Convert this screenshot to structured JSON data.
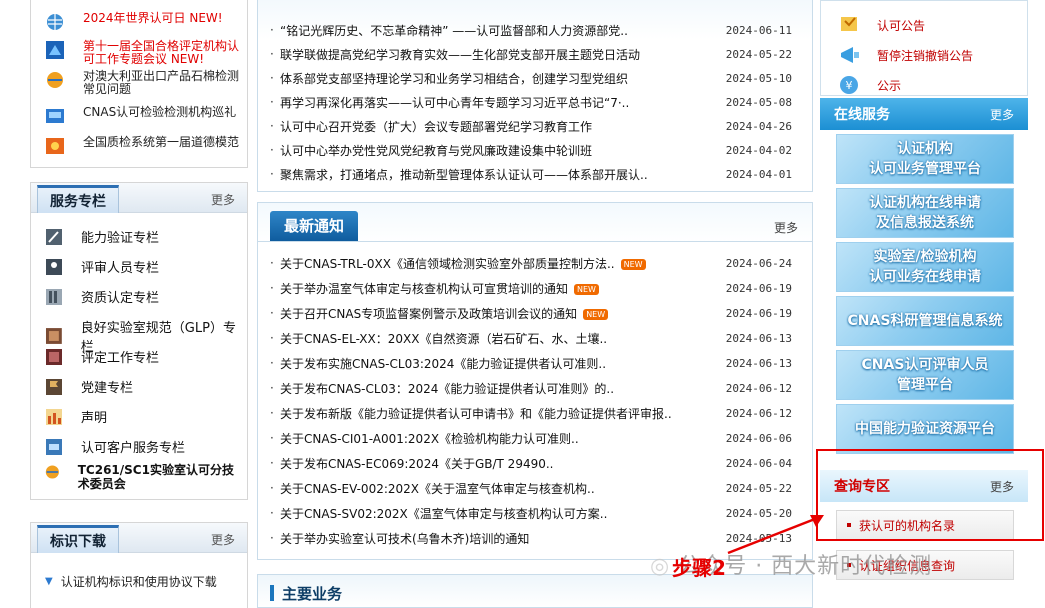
{
  "left": {
    "top_items": [
      {
        "icon": "globe-icon",
        "text": "2024年世界认可日 NEW!",
        "red": true
      },
      {
        "icon": "flag-icon",
        "text": "第十一届全国合格评定机构认可工作专题会议 NEW!",
        "red": true
      },
      {
        "icon": "globe-icon",
        "text": "对澳大利亚出口产品石棉检测常见问题",
        "red": false
      },
      {
        "icon": "building-icon",
        "text": "CNAS认可检验检测机构巡礼",
        "red": false
      },
      {
        "icon": "award-icon",
        "text": "全国质检系统第一届道德模范",
        "red": false
      }
    ],
    "service_panel": {
      "title": "服务专栏",
      "more": "更多",
      "items": [
        {
          "icon": "pen-icon",
          "label": "能力验证专栏"
        },
        {
          "icon": "people-icon",
          "label": "评审人员专栏"
        },
        {
          "icon": "book-icon",
          "label": "资质认定专栏"
        },
        {
          "icon": "book-icon",
          "label": "良好实验室规范（GLP）专栏"
        },
        {
          "icon": "document-icon",
          "label": "评定工作专栏"
        },
        {
          "icon": "flag-icon",
          "label": "党建专栏"
        },
        {
          "icon": "chart-icon",
          "label": "声明"
        },
        {
          "icon": "service-icon",
          "label": "认可客户服务专栏"
        },
        {
          "icon": "globe-icon",
          "label": "TC261/SC1实验室认可分技术委员会"
        }
      ]
    },
    "download_panel": {
      "title": "标识下载",
      "more": "更多",
      "items": [
        "认证机构标识和使用协议下载"
      ]
    }
  },
  "middle": {
    "top_news": [
      {
        "title": "“铭记光辉历史、不忘革命精神” ——认可监督部和人力资源部党..",
        "date": "2024-06-11"
      },
      {
        "title": "联学联做提高党纪学习教育实效——生化部党支部开展主题党日活动",
        "date": "2024-05-22"
      },
      {
        "title": "体系部党支部坚持理论学习和业务学习相结合，创建学习型党组织",
        "date": "2024-05-10"
      },
      {
        "title": "再学习再深化再落实——认可中心青年专题学习习近平总书记“7·..",
        "date": "2024-05-08"
      },
      {
        "title": "认可中心召开党委（扩大）会议专题部署党纪学习教育工作",
        "date": "2024-04-26"
      },
      {
        "title": "认可中心举办党性党风党纪教育与党风廉政建设集中轮训班",
        "date": "2024-04-02"
      },
      {
        "title": "聚焦需求，打通堵点，推动新型管理体系认证认可——体系部开展认..",
        "date": "2024-04-01"
      }
    ],
    "latest": {
      "title": "最新通知",
      "more": "更多",
      "new_badge": "NEW",
      "items": [
        {
          "title": "关于CNAS-TRL-0XX《通信领域检测实验室外部质量控制方法..",
          "date": "2024-06-24",
          "new": true
        },
        {
          "title": "关于举办温室气体审定与核查机构认可宣贯培训的通知",
          "date": "2024-06-19",
          "new": true
        },
        {
          "title": "关于召开CNAS专项监督案例警示及政策培训会议的通知",
          "date": "2024-06-19",
          "new": true
        },
        {
          "title": "关于CNAS-EL-XX：20XX《自然资源（岩石矿石、水、土壤..",
          "date": "2024-06-13",
          "new": false
        },
        {
          "title": "关于发布实施CNAS-CL03:2024《能力验证提供者认可准则..",
          "date": "2024-06-13",
          "new": false
        },
        {
          "title": "关于发布CNAS-CL03：2024《能力验证提供者认可准则》的..",
          "date": "2024-06-12",
          "new": false
        },
        {
          "title": "关于发布新版《能力验证提供者认可申请书》和《能力验证提供者评审报..",
          "date": "2024-06-12",
          "new": false
        },
        {
          "title": "关于CNAS-CI01-A001:202X《检验机构能力认可准则..",
          "date": "2024-06-06",
          "new": false
        },
        {
          "title": "关于发布CNAS-EC069:2024《关于GB/T 29490..",
          "date": "2024-06-04",
          "new": false
        },
        {
          "title": "关于CNAS-EV-002:202X《关于温室气体审定与核查机构..",
          "date": "2024-05-22",
          "new": false
        },
        {
          "title": "关于CNAS-SV02:202X《温室气体审定与核查机构认可方案..",
          "date": "2024-05-20",
          "new": false
        },
        {
          "title": "关于举办实验室认可技术(乌鲁木齐)培训的通知",
          "date": "2024-05-13",
          "new": false
        }
      ]
    },
    "main_business": "主要业务"
  },
  "right": {
    "top_items": [
      {
        "icon": "certificate-icon",
        "label": "认可公告"
      },
      {
        "icon": "notice-icon",
        "label": "暂停注销撤销公告"
      },
      {
        "icon": "yen-icon",
        "label": "公示"
      }
    ],
    "online": {
      "title": "在线服务",
      "more": "更多",
      "buttons": [
        [
          "认证机构",
          "认可业务管理平台"
        ],
        [
          "认证机构在线申请",
          "及信息报送系统"
        ],
        [
          "实验室/检验机构",
          "认可业务在线申请"
        ],
        [
          "CNAS科研管理信息系统"
        ],
        [
          "CNAS认可评审人员",
          "管理平台"
        ],
        [
          "中国能力验证资源平台"
        ]
      ]
    },
    "query": {
      "title": "查询专区",
      "more": "更多",
      "items": [
        "获认可的机构名录",
        "认证组织信息查询"
      ]
    }
  },
  "overlay": {
    "step_label": "步骤2",
    "watermark": "公众号 · 西大新时代检测"
  },
  "colors": {
    "accent_blue": "#1c8fd3",
    "alert_red": "#e60000"
  }
}
